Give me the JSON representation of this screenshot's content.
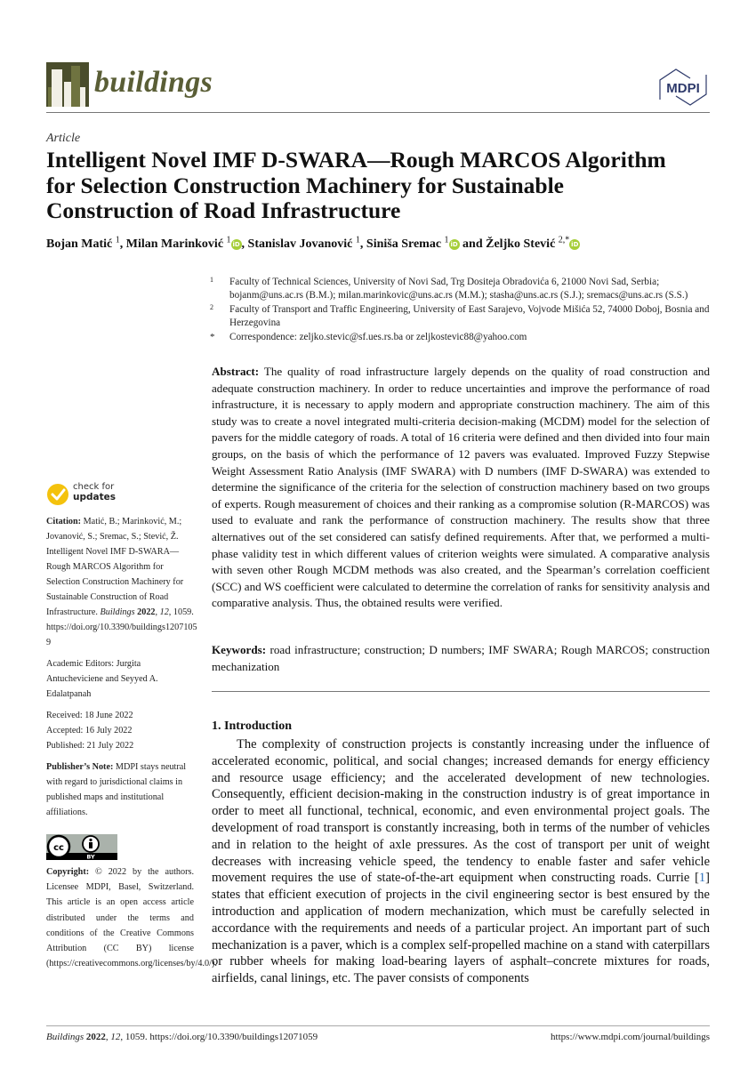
{
  "header": {
    "journal_name": "buildings",
    "publisher_logo_text": "MDPI",
    "brand_color": "#5a5e36"
  },
  "article_type": "Article",
  "title": "Intelligent Novel IMF D-SWARA—Rough MARCOS Algorithm for Selection Construction Machinery for Sustainable Construction of Road Infrastructure",
  "authors": [
    {
      "name": "Bojan Matić",
      "sup": "1",
      "orcid": false,
      "sep": ", "
    },
    {
      "name": "Milan Marinković",
      "sup": "1",
      "orcid": true,
      "sep": ", "
    },
    {
      "name": "Stanislav Jovanović",
      "sup": "1",
      "orcid": false,
      "sep": ", "
    },
    {
      "name": "Siniša Sremac",
      "sup": "1",
      "orcid": true,
      "sep": " and "
    },
    {
      "name": "Željko Stević",
      "sup": "2,*",
      "orcid": true,
      "sep": ""
    }
  ],
  "affiliations": [
    {
      "mark": "1",
      "text": "Faculty of Technical Sciences, University of Novi Sad, Trg Dositeja Obradovića 6, 21000 Novi Sad, Serbia; bojanm@uns.ac.rs (B.M.); milan.marinkovic@uns.ac.rs (M.M.); stasha@uns.ac.rs (S.J.); sremacs@uns.ac.rs (S.S.)"
    },
    {
      "mark": "2",
      "text": "Faculty of Transport and Traffic Engineering, University of East Sarajevo, Vojvode Mišića 52, 74000 Doboj, Bosnia and Herzegovina"
    },
    {
      "mark": "*",
      "text": "Correspondence: zeljko.stevic@sf.ues.rs.ba or zeljkostevic88@yahoo.com"
    }
  ],
  "abstract": {
    "label": "Abstract:",
    "text": "The quality of road infrastructure largely depends on the quality of road construction and adequate construction machinery. In order to reduce uncertainties and improve the performance of road infrastructure, it is necessary to apply modern and appropriate construction machinery. The aim of this study was to create a novel integrated multi-criteria decision-making (MCDM) model for the selection of pavers for the middle category of roads. A total of 16 criteria were defined and then divided into four main groups, on the basis of which the performance of 12 pavers was evaluated. Improved Fuzzy Stepwise Weight Assessment Ratio Analysis (IMF SWARA) with D numbers (IMF D-SWARA) was extended to determine the significance of the criteria for the selection of construction machinery based on two groups of experts. Rough measurement of choices and their ranking as a compromise solution (R-MARCOS) was used to evaluate and rank the performance of construction machinery. The results show that three alternatives out of the set considered can satisfy defined requirements. After that, we performed a multi-phase validity test in which different values of criterion weights were simulated. A comparative analysis with seven other Rough MCDM methods was also created, and the Spearman’s correlation coefficient (SCC) and WS coefficient were calculated to determine the correlation of ranks for sensitivity analysis and comparative analysis. Thus, the obtained results were verified."
  },
  "keywords": {
    "label": "Keywords:",
    "text": "road infrastructure; construction; D numbers; IMF SWARA; Rough MARCOS; construction mechanization"
  },
  "introduction": {
    "heading": "1. Introduction",
    "text_before_cite": "The complexity of construction projects is constantly increasing under the influence of accelerated economic, political, and social changes; increased demands for energy efficiency and resource usage efficiency; and the accelerated development of new technologies. Consequently, efficient decision-making in the construction industry is of great importance in order to meet all functional, technical, economic, and even environmental project goals. The development of road transport is constantly increasing, both in terms of the number of vehicles and in relation to the height of axle pressures. As the cost of transport per unit of weight decreases with increasing vehicle speed, the tendency to enable faster and safer vehicle movement requires the use of state-of-the-art equipment when constructing roads. Currie [",
    "cite": "1",
    "text_after_cite": "] states that efficient execution of projects in the civil engineering sector is best ensured by the introduction and application of modern mechanization, which must be carefully selected in accordance with the requirements and needs of a particular project. An important part of such mechanization is a paver, which is a complex self-propelled machine on a stand with caterpillars or rubber wheels for making load-bearing layers of asphalt–concrete mixtures for roads, airfields, canal linings, etc. The paver consists of components"
  },
  "sidebar": {
    "check_updates": {
      "line1": "check for",
      "line2": "updates"
    },
    "citation": {
      "label": "Citation:",
      "text": "Matić, B.; Marinković, M.; Jovanović, S.; Sremac, S.; Stević, Ž. Intelligent Novel IMF D-SWARA—Rough MARCOS Algorithm for Selection Construction Machinery for Sustainable Construction of Road Infrastructure.",
      "journal": "Buildings",
      "year": "2022",
      "volume": "12",
      "article": ", 1059.",
      "doi": "https://doi.org/10.3390/buildings12071059"
    },
    "editors": "Academic Editors: Jurgita Antucheviciene and Seyyed A. Edalatpanah",
    "received": "Received: 18 June 2022",
    "accepted": "Accepted: 16 July 2022",
    "published": "Published: 21 July 2022",
    "publisher_note": {
      "label": "Publisher’s Note:",
      "text": "MDPI stays neutral with regard to jurisdictional claims in published maps and institutional affiliations."
    },
    "cc_badge": {
      "cc": "cc",
      "by": "BY"
    },
    "copyright": {
      "label": "Copyright:",
      "text": "© 2022 by the authors. Licensee MDPI, Basel, Switzerland. This article is an open access article distributed under the terms and conditions of the Creative Commons Attribution (CC BY) license (https://creativecommons.org/licenses/by/4.0/)."
    }
  },
  "footer": {
    "journal": "Buildings",
    "year": "2022",
    "volume": "12",
    "rest": ", 1059. https://doi.org/10.3390/buildings12071059",
    "url": "https://www.mdpi.com/journal/buildings"
  }
}
